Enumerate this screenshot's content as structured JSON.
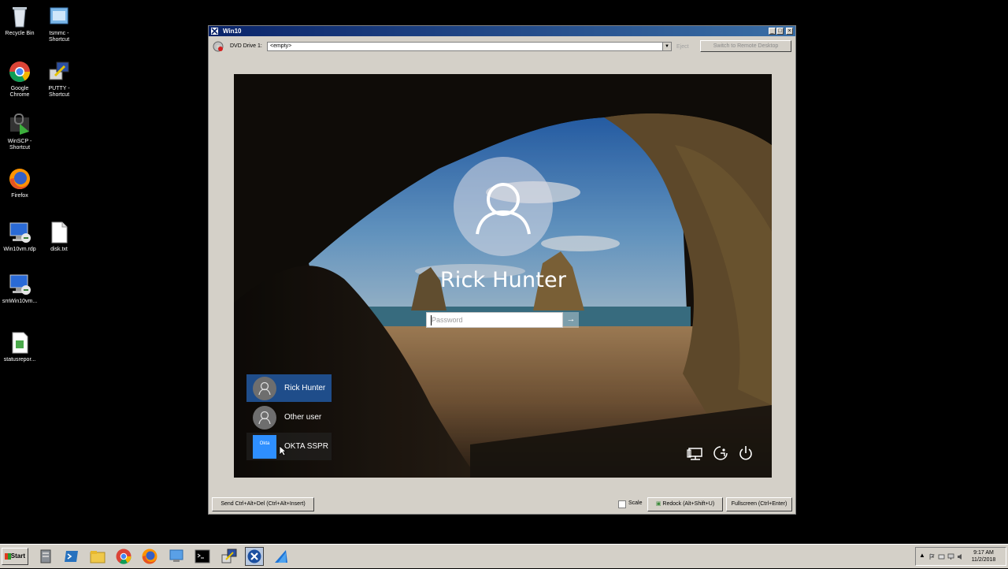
{
  "desktop": {
    "icons": [
      {
        "name": "recycle-bin",
        "label": "Recycle Bin"
      },
      {
        "name": "tsmmc-shortcut",
        "label": "tsmmc - Shortcut"
      },
      {
        "name": "google-chrome",
        "label": "Google Chrome"
      },
      {
        "name": "putty-shortcut",
        "label": "PUTTY - Shortcut"
      },
      {
        "name": "winscp-shortcut",
        "label": "WinSCP - Shortcut"
      },
      {
        "name": "firefox",
        "label": "Firefox"
      },
      {
        "name": "win10vm-rdp",
        "label": "Win10vm.rdp"
      },
      {
        "name": "disk-txt",
        "label": "disk.txt"
      },
      {
        "name": "smwin10vm",
        "label": "smWin10vm..."
      },
      {
        "name": "statusreport",
        "label": "statusrepor..."
      }
    ]
  },
  "vm_window": {
    "title": "Win10",
    "dvd_label": "DVD Drive 1:",
    "dvd_value": "<empty>",
    "eject_label": "Eject",
    "remote_desktop_label": "Switch to Remote Desktop",
    "login": {
      "user_name": "Rick Hunter",
      "password_placeholder": "Password",
      "submit_icon": "arrow-right-icon",
      "users": [
        {
          "name": "Rick Hunter",
          "selected": true
        },
        {
          "name": "Other user",
          "selected": false
        },
        {
          "name": "OKTA SSPR",
          "selected": false,
          "logo_text": "Okta"
        }
      ],
      "system_icons": [
        "network-icon",
        "ease-of-access-icon",
        "power-icon"
      ]
    },
    "bottom": {
      "send_cad_label": "Send Ctrl+Alt+Del (Ctrl+Alt+Insert)",
      "scale_label": "Scale",
      "scale_checked": false,
      "redock_label": "Redock (Alt+Shift+U)",
      "fullscreen_label": "Fullscreen (Ctrl+Enter)"
    }
  },
  "taskbar": {
    "start_label": "Start",
    "clock_time": "9:17 AM",
    "clock_date": "11/2/2018"
  },
  "colors": {
    "selected_user": "#1f4d8a",
    "okta_tile": "#2e8fff",
    "titlebar": "#0a246a"
  }
}
